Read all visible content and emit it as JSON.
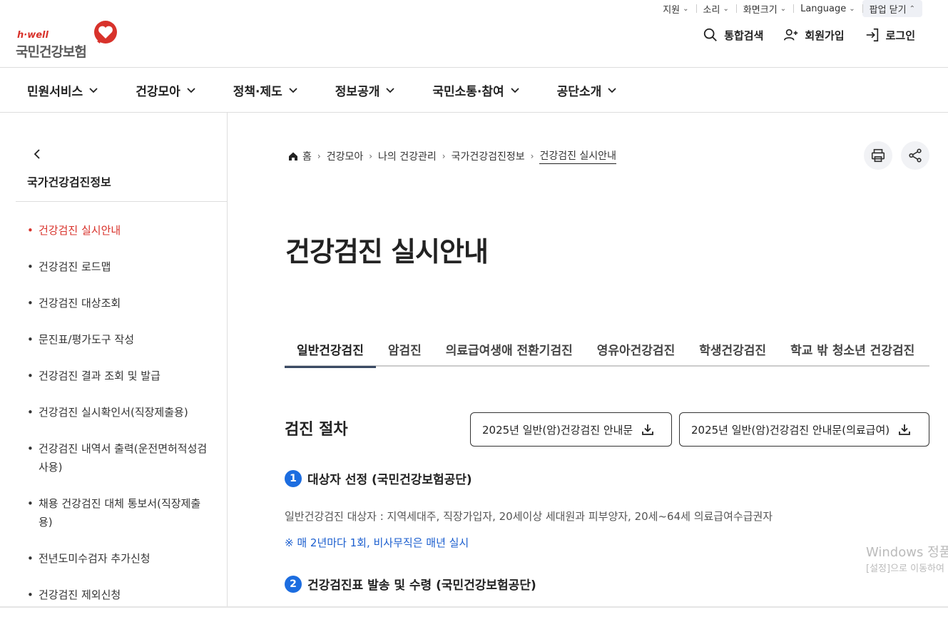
{
  "util": {
    "items": [
      "지원",
      "소리",
      "화면크기",
      "Language"
    ],
    "popup_close": "팝업 닫기"
  },
  "logo": {
    "brand": "h·well",
    "org": "국민건강보험"
  },
  "header_actions": {
    "search": "통합검색",
    "signup": "회원가입",
    "login": "로그인"
  },
  "gnb": [
    "민원서비스",
    "건강모아",
    "정책·제도",
    "정보공개",
    "국민소통·참여",
    "공단소개"
  ],
  "sidebar": {
    "title": "국가건강검진정보",
    "items": [
      "건강검진 실시안내",
      "건강검진 로드맵",
      "건강검진 대상조회",
      "문진표/평가도구 작성",
      "건강검진 결과 조회 및 발급",
      "건강검진 실시확인서(직장제출용)",
      "건강검진 내역서 출력(운전면허적성검사용)",
      "채용 건강검진 대체 통보서(직장제출용)",
      "전년도미수검자 추가신청",
      "건강검진 제외신청"
    ]
  },
  "breadcrumb": [
    "홈",
    "건강모아",
    "나의 건강관리",
    "국가건강검진정보",
    "건강검진 실시안내"
  ],
  "page_title": "건강검진 실시안내",
  "tabs": [
    "일반건강검진",
    "암검진",
    "의료급여생애 전환기검진",
    "영유아건강검진",
    "학생건강검진",
    "학교 밖 청소년 건강검진"
  ],
  "section": {
    "title": "검진 절차",
    "download1": "2025년 일반(암)건강검진 안내문",
    "download2": "2025년 일반(암)건강검진 안내문(의료급여)"
  },
  "steps": [
    {
      "num": "1",
      "title": "대상자 선정 (국민건강보험공단)"
    },
    {
      "num": "2",
      "title": "건강검진표 발송 및 수령 (국민건강보험공단)"
    }
  ],
  "step1_desc": "일반건강검진 대상자 : 지역세대주, 직장가입자, 20세이상 세대원과 피부양자, 20세~64세 의료급여수급권자",
  "step1_note": "※ 매 2년마다 1회, 비사무직은 매년 실시",
  "watermark": {
    "line1": "Windows 정품",
    "line2": "[설정]으로 이동하여"
  },
  "colors": {
    "accent_red": "#d8322b",
    "step_blue": "#1c6de0",
    "note_blue": "#1c5fcf"
  }
}
